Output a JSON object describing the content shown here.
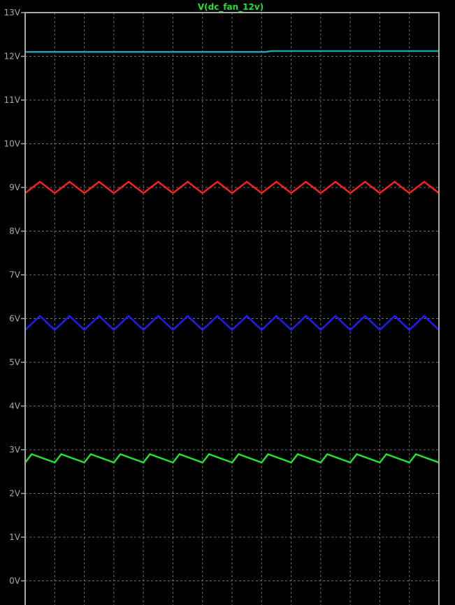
{
  "trace_title": "V(dc_fan_12v)",
  "colors": {
    "background": "#000000",
    "frame": "#a8a8a8",
    "grid": "#6e6e6e",
    "label": "#a8a8a8",
    "title": "#22e030"
  },
  "chart_data": {
    "type": "line",
    "title": "V(dc_fan_12v)",
    "xlabel": "",
    "ylabel": "",
    "ylim": [
      -0.6,
      13
    ],
    "xlim": [
      0,
      14
    ],
    "y_ticks": [
      {
        "value": 13,
        "label": "13V"
      },
      {
        "value": 12,
        "label": "12V"
      },
      {
        "value": 11,
        "label": "11V"
      },
      {
        "value": 10,
        "label": "10V"
      },
      {
        "value": 9,
        "label": "9V"
      },
      {
        "value": 8,
        "label": "8V"
      },
      {
        "value": 7,
        "label": "7V"
      },
      {
        "value": 6,
        "label": "6V"
      },
      {
        "value": 5,
        "label": "5V"
      },
      {
        "value": 4,
        "label": "4V"
      },
      {
        "value": 3,
        "label": "3V"
      },
      {
        "value": 2,
        "label": "2V"
      },
      {
        "value": 1,
        "label": "1V"
      },
      {
        "value": 0,
        "label": "0V"
      }
    ],
    "x_grid_count": 14,
    "grid": true,
    "series": [
      {
        "color": "#20a0a8",
        "mode": "flat",
        "level": 12.1,
        "cycles": 14,
        "amplitude": 0
      },
      {
        "color": "#ff2020",
        "mode": "zigzag",
        "level": 9.0,
        "cycles": 14,
        "amplitude": 0.13
      },
      {
        "color": "#1e1ef0",
        "mode": "zigzag",
        "level": 5.9,
        "cycles": 14,
        "amplitude": 0.16
      },
      {
        "color": "#22e030",
        "mode": "sawtooth",
        "level": 2.78,
        "cycles": 14,
        "amplitude": 0.12
      }
    ]
  }
}
